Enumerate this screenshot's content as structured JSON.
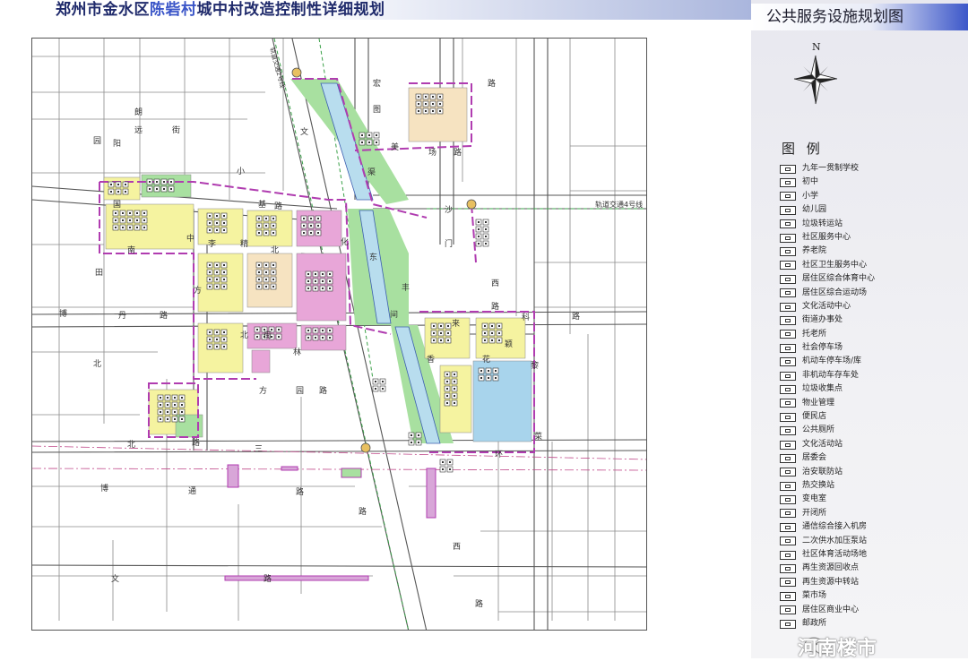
{
  "header": {
    "title_pre": "郑州市金水区",
    "title_highlight": "陈砦村",
    "title_post": "城中村改造控制性详细规划"
  },
  "panel": {
    "title": "公共服务设施规划图"
  },
  "north": {
    "label": "N"
  },
  "legend": {
    "title": "图 例",
    "items": [
      {
        "label": "九年一贯制学校"
      },
      {
        "label": "初中"
      },
      {
        "label": "小学"
      },
      {
        "label": "幼儿园"
      },
      {
        "label": "垃圾转运站"
      },
      {
        "label": "社区服务中心"
      },
      {
        "label": "养老院"
      },
      {
        "label": "社区卫生服务中心"
      },
      {
        "label": "居住区综合体育中心"
      },
      {
        "label": "居住区综合运动场"
      },
      {
        "label": "文化活动中心"
      },
      {
        "label": "街道办事处"
      },
      {
        "label": "托老所"
      },
      {
        "label": "社会停车场"
      },
      {
        "label": "机动车停车场/库"
      },
      {
        "label": "非机动车存车处"
      },
      {
        "label": "垃圾收集点"
      },
      {
        "label": "物业管理"
      },
      {
        "label": "便民店"
      },
      {
        "label": "公共厕所"
      },
      {
        "label": "文化活动站"
      },
      {
        "label": "居委会"
      },
      {
        "label": "治安联防站"
      },
      {
        "label": "热交换站"
      },
      {
        "label": "变电室"
      },
      {
        "label": "开闭所"
      },
      {
        "label": "通信综合接入机房"
      },
      {
        "label": "二次供水加压泵站"
      },
      {
        "label": "社区体育活动场地"
      },
      {
        "label": "再生资源回收点"
      },
      {
        "label": "再生资源中转站"
      },
      {
        "label": "菜市场"
      },
      {
        "label": "居住区商业中心"
      },
      {
        "label": "邮政所"
      }
    ]
  },
  "map": {
    "road_labels": [
      {
        "text": "宏"
      },
      {
        "text": "图"
      },
      {
        "text": "路"
      },
      {
        "text": "朗"
      },
      {
        "text": "远"
      },
      {
        "text": "街"
      },
      {
        "text": "园"
      },
      {
        "text": "阳"
      },
      {
        "text": "小"
      },
      {
        "text": "文"
      },
      {
        "text": "渠"
      },
      {
        "text": "美"
      },
      {
        "text": "场"
      },
      {
        "text": "路"
      },
      {
        "text": "国"
      },
      {
        "text": "基"
      },
      {
        "text": "路"
      },
      {
        "text": "中"
      },
      {
        "text": "李"
      },
      {
        "text": "精"
      },
      {
        "text": "北"
      },
      {
        "text": "南"
      },
      {
        "text": "田"
      },
      {
        "text": "方"
      },
      {
        "text": "化"
      },
      {
        "text": "东"
      },
      {
        "text": "丰"
      },
      {
        "text": "博"
      },
      {
        "text": "丹"
      },
      {
        "text": "路"
      },
      {
        "text": "西"
      },
      {
        "text": "路"
      },
      {
        "text": "间"
      },
      {
        "text": "科"
      },
      {
        "text": "路"
      },
      {
        "text": "来"
      },
      {
        "text": "颖"
      },
      {
        "text": "北"
      },
      {
        "text": "街"
      },
      {
        "text": "林"
      },
      {
        "text": "北"
      },
      {
        "text": "方"
      },
      {
        "text": "园"
      },
      {
        "text": "路"
      },
      {
        "text": "北"
      },
      {
        "text": "路"
      },
      {
        "text": "三"
      },
      {
        "text": "香"
      },
      {
        "text": "花"
      },
      {
        "text": "黎"
      },
      {
        "text": "菜"
      },
      {
        "text": "环"
      },
      {
        "text": "博"
      },
      {
        "text": "通"
      },
      {
        "text": "路"
      },
      {
        "text": "路"
      },
      {
        "text": "西"
      },
      {
        "text": "文"
      },
      {
        "text": "路"
      },
      {
        "text": "路"
      },
      {
        "text": "沙"
      },
      {
        "text": "门"
      }
    ],
    "rail_label": "轨道交通4号线",
    "rail_label_2": "轨道交通2号线"
  },
  "watermark": {
    "text": "河南楼市"
  },
  "colors": {
    "residential": "#f5f3a0",
    "residential_dark": "#e6e08c",
    "pinkish": "#e8a6d8",
    "peach": "#f6e3c1",
    "green": "#a8e0a0",
    "water": "#b8ddee",
    "boundary": "#b03cb0",
    "title_blue": "#1f2a6b"
  }
}
